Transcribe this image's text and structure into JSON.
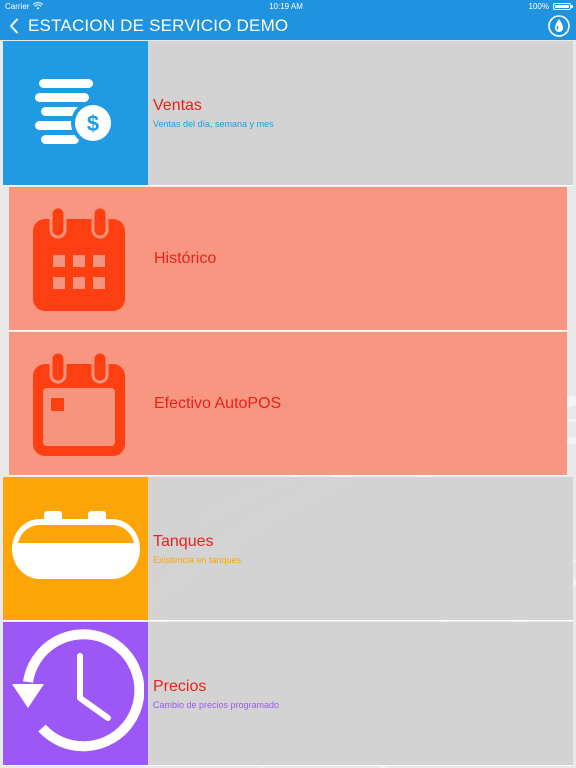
{
  "status_bar": {
    "carrier": "Carrier",
    "time": "10:19 AM",
    "battery": "100%"
  },
  "nav": {
    "title": "ESTACION DE SERVICIO DEMO"
  },
  "colors": {
    "nav": "#1f93e0",
    "ventas_tile": "#1e9be3",
    "historico_icon": "#fe3f12",
    "tanques_tile": "#fda406",
    "precios_tile": "#9c58f6",
    "title_red": "#e8221b"
  },
  "menu": [
    {
      "title": "Ventas",
      "subtitle": "Ventas del día, semana y mes",
      "icon": "coins-dollar-icon"
    },
    {
      "title": "Histórico",
      "subtitle": "",
      "icon": "calendar-grid-icon"
    },
    {
      "title": "Efectivo AutoPOS",
      "subtitle": "",
      "icon": "calendar-icon"
    },
    {
      "title": "Tanques",
      "subtitle": "Existencia en tanques",
      "icon": "tank-icon"
    },
    {
      "title": "Precios",
      "subtitle": "Cambio de precios programado",
      "icon": "clock-history-icon"
    }
  ]
}
